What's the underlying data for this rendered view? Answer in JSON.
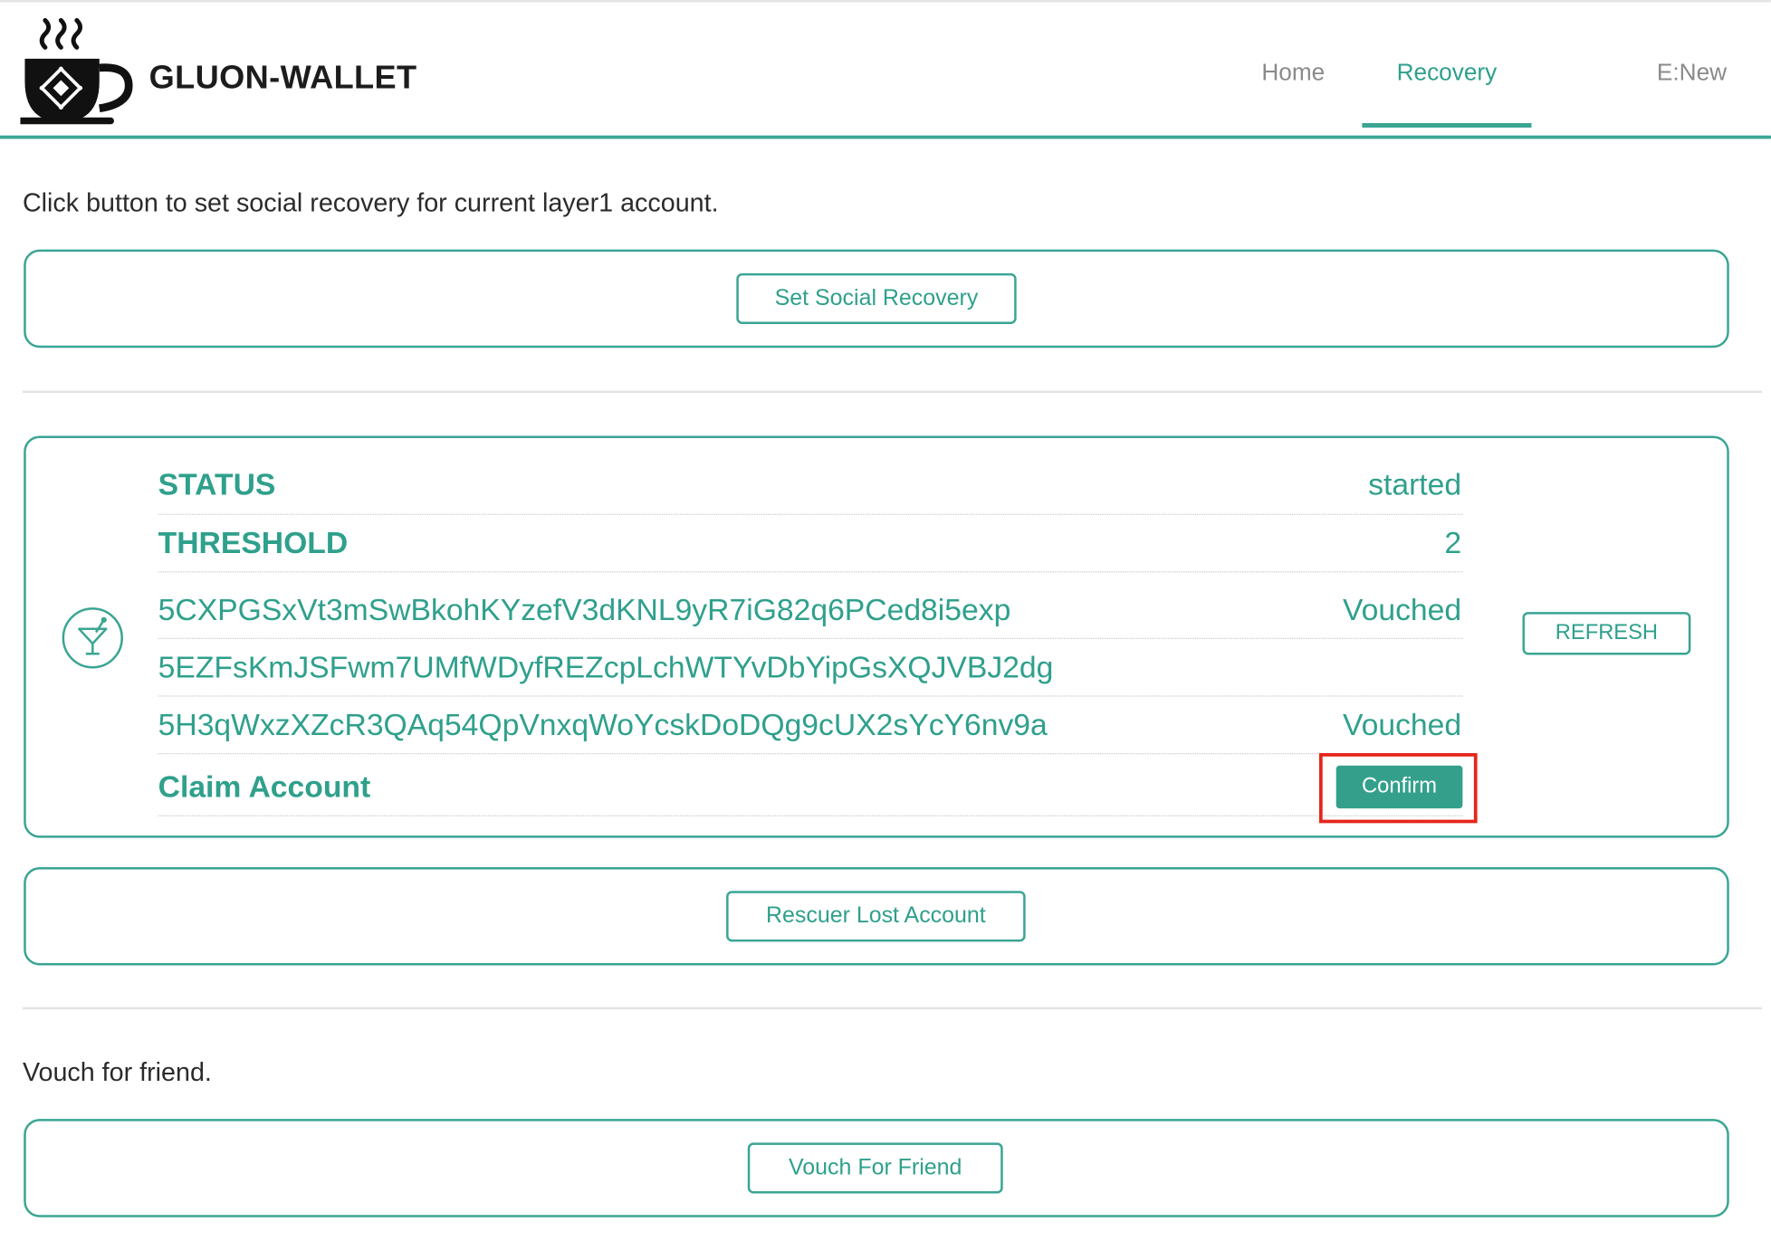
{
  "header": {
    "title": "GLUON-WALLET",
    "nav": {
      "home": "Home",
      "recovery": "Recovery",
      "account": "E:New"
    },
    "active_tab": "Recovery"
  },
  "social_recovery": {
    "intro": "Click button to set social recovery for current layer1 account.",
    "button_label": "Set Social Recovery"
  },
  "status_panel": {
    "icon": "cocktail-icon",
    "rows": [
      {
        "label": "STATUS",
        "value": "started"
      },
      {
        "label": "THRESHOLD",
        "value": "2"
      },
      {
        "label": "5CXPGSxVt3mSwBkohKYzefV3dKNL9yR7iG82q6PCed8i5exp",
        "value": "Vouched"
      },
      {
        "label": "5EZFsKmJSFwm7UMfWDyfREZcpLchWTYvDbYipGsXQJVBJ2dg",
        "value": ""
      },
      {
        "label": "5H3qWxzXZcR3QAq54QpVnxqWoYcskDoDQg9cUX2sYcY6nv9a",
        "value": "Vouched"
      }
    ],
    "claim_label": "Claim Account",
    "confirm_label": "Confirm",
    "refresh_label": "REFRESH"
  },
  "rescue": {
    "button_label": "Rescuer Lost Account"
  },
  "vouch": {
    "intro": "Vouch for friend.",
    "button_label": "Vouch For Friend"
  },
  "colors": {
    "accent": "#3aa593",
    "highlight": "#e5261b"
  }
}
